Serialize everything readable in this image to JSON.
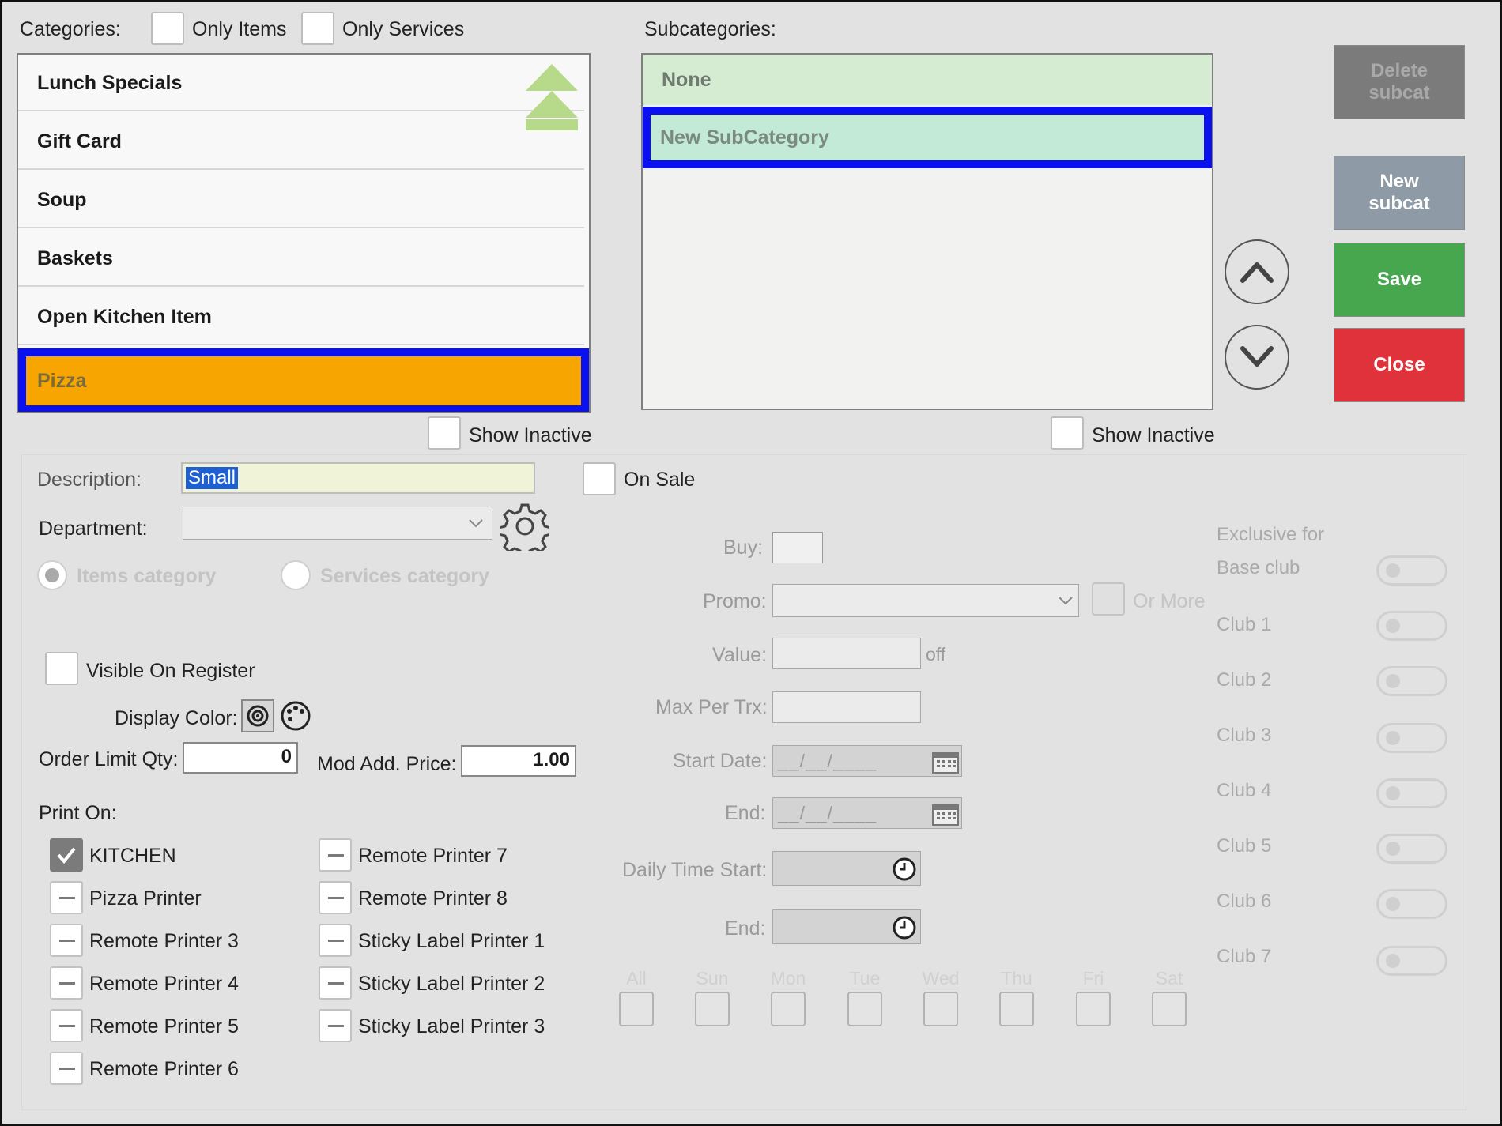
{
  "categories": {
    "label": "Categories:",
    "only_items": "Only Items",
    "only_services": "Only Services",
    "items": [
      "Lunch Specials",
      "Gift Card",
      "Soup",
      "Baskets",
      "Open Kitchen Item",
      "Pizza"
    ],
    "selected": "Pizza",
    "show_inactive": "Show Inactive"
  },
  "subcategories": {
    "label": "Subcategories:",
    "items": [
      "None",
      "New SubCategory"
    ],
    "selected": "New SubCategory",
    "show_inactive": "Show Inactive"
  },
  "buttons": {
    "delete_subcat": "Delete subcat",
    "new_subcat": "New subcat",
    "save": "Save",
    "close": "Close"
  },
  "form": {
    "description_label": "Description:",
    "description_value": "Small",
    "on_sale": "On Sale",
    "department_label": "Department:",
    "department_value": "",
    "items_category": "Items category",
    "services_category": "Services category",
    "visible_on_register": "Visible On Register",
    "display_color_label": "Display Color:",
    "order_limit_label": "Order Limit Qty:",
    "order_limit_value": "0",
    "mod_add_price_label": "Mod Add. Price:",
    "mod_add_price_value": "1.00",
    "print_on_label": "Print On:"
  },
  "printers": [
    {
      "name": "KITCHEN",
      "checked": true
    },
    {
      "name": "Pizza Printer",
      "checked": false
    },
    {
      "name": "Remote Printer 3",
      "checked": false
    },
    {
      "name": "Remote Printer 4",
      "checked": false
    },
    {
      "name": "Remote Printer 5",
      "checked": false
    },
    {
      "name": "Remote Printer 6",
      "checked": false
    },
    {
      "name": "Remote Printer 7",
      "checked": false
    },
    {
      "name": "Remote Printer 8",
      "checked": false
    },
    {
      "name": "Sticky Label Printer 1",
      "checked": false
    },
    {
      "name": "Sticky Label Printer 2",
      "checked": false
    },
    {
      "name": "Sticky Label Printer 3",
      "checked": false
    }
  ],
  "promo": {
    "buy_label": "Buy:",
    "promo_label": "Promo:",
    "or_more": "Or More",
    "value_label": "Value:",
    "off": "off",
    "max_per_trx_label": "Max Per Trx:",
    "start_date_label": "Start Date:",
    "start_date_value": "__/__/____",
    "end_label": "End:",
    "end_date_value": "__/__/____",
    "daily_time_start_label": "Daily Time Start:",
    "daily_end_label": "End:",
    "days": [
      "All",
      "Sun",
      "Mon",
      "Tue",
      "Wed",
      "Thu",
      "Fri",
      "Sat"
    ]
  },
  "clubs": {
    "header_line1": "Exclusive for",
    "items": [
      "Base club",
      "Club 1",
      "Club 2",
      "Club 3",
      "Club 4",
      "Club 5",
      "Club 6",
      "Club 7"
    ]
  },
  "colors": {
    "selected_category": "#f7a500",
    "selection_border": "#0a10f0",
    "subcat_none": "#d6ecd2",
    "subcat_selected": "#c3ead6",
    "save": "#47a74f",
    "close": "#e0323a",
    "new_subcat": "#8e9ba7",
    "delete_subcat": "#7b7b7b"
  }
}
